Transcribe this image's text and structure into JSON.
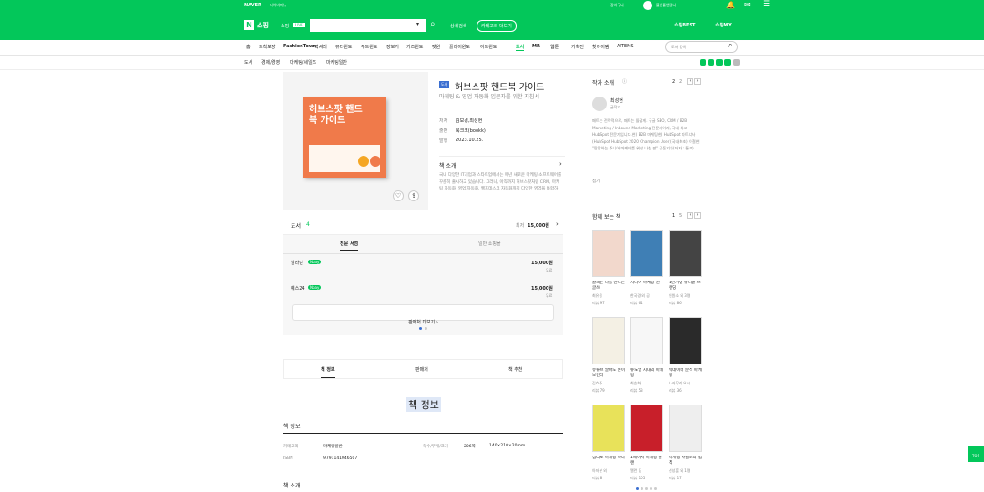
{
  "top": {
    "naver": "NAVER",
    "menu": "네이버메뉴",
    "pay": "장바구니",
    "user": "블신플앤클니",
    "icons": [
      "bell-icon",
      "mail-icon",
      "menu-icon"
    ]
  },
  "header": {
    "logo_n": "N",
    "logo_text": "쇼핑",
    "tab": "쇼핑",
    "live": "LIVE",
    "detail": "상세검색",
    "category": "카테고리 더보기",
    "best": "쇼핑BEST",
    "my": "쇼핑MY"
  },
  "nav": [
    "홈",
    "도착보장",
    "FashionTown",
    "럭셔리",
    "뷰티윈도",
    "푸드윈도",
    "장보기",
    "키즈윈도",
    "펫윈",
    "플레이윈도",
    "아트윈도",
    "도서",
    "MR",
    "웹툰",
    "기획전",
    "핫이이템",
    "AITEMS"
  ],
  "nav_search_placeholder": "도서 검색",
  "breadcrumb": [
    "도서",
    "경제/경영",
    "마케팅/세일즈",
    "마케팅일반"
  ],
  "book": {
    "tag": "도서",
    "title": "허브스팟 핸드북 가이드",
    "subtitle": "마케팅 & 영업 자동화 입문자를 위한 지침서",
    "author_label": "저자",
    "author": "김보경,최성현",
    "pub_label": "출판",
    "publisher": "북크크(bookk)",
    "date_label": "발행",
    "date": "2023.10.25.",
    "cover_title": "허브스팟 핸드북 가이드",
    "intro_title": "책 소개",
    "intro": "국내 다양한 IT기업과 스타트업에서는 매년 새로운 마케팅 소프트웨어를 꾸준히 출시하고 있습니다. 그러나, 아직까지 허브스팟처럼 CRM, 마케팅 자동화, 영업 자동화, 헬프데스크 자동화까지 다양한 영역을 통합하"
  },
  "stores": {
    "label": "도서",
    "count": "4",
    "lowest_label": "최저",
    "lowest": "15,000원",
    "tab1": "전문 서점",
    "tab2": "일반 쇼핑몰",
    "rows": [
      {
        "name": "알라딘",
        "pay": "Npay",
        "price": "15,000원",
        "ship": "무료"
      },
      {
        "name": "예스24",
        "pay": "Npay",
        "price": "15,000원",
        "ship": "무료"
      }
    ],
    "more": "판매처 더보기"
  },
  "tabs": [
    "책 정보",
    "판매처",
    "책 추천"
  ],
  "info": {
    "big_title": "책 정보",
    "section": "책 정보",
    "cat_label": "카테고리",
    "cat": "마케팅일반",
    "pages_label": "쪽수/무게/크기",
    "pages": "206쪽",
    "size": "140×210×20mm",
    "isbn_label": "ISBN",
    "isbn": "9791141046507",
    "intro2": "책 소개"
  },
  "author_box": {
    "title": "작가 소개",
    "page": "2",
    "total": "2",
    "name": "최성현",
    "role": "글작가",
    "text": "패트는 전략적으로, 패트는 뜰감게. 구글 SEO, CRM / B2B Marketing / Inbound Marketing 전문가이자, 국내 최고 HubSpot 전문가입니다.현) B2B 마케팅현) HubSpot 파트너사 (HubSpot HubSpot 2020 Champion User)(국내최초) 이철현 \"팡팡하는 주니어 마케터를 위한 나침 판\" 공동기자(저자 : 통조)",
    "more": "접기"
  },
  "recs": {
    "title": "함께 보는 책",
    "page": "1",
    "total": "5",
    "items": [
      {
        "t": "끌리는 나를 만드는 글쓰",
        "a": "최유웅",
        "r": "리뷰 97"
      },
      {
        "t": "시니어 마케팅 전",
        "a": "한국경 외 공",
        "r": "리뷰 61"
      },
      {
        "t": "1인기업 유니얼 브랜딩",
        "a": "인원소 외 3명",
        "r": "리뷰 86"
      },
      {
        "t": "유튜브 알바도 돈이 보인다",
        "a": "김효주",
        "r": "리뷰 79"
      },
      {
        "t": "뉴노멀 시대의 마케팅",
        "a": "최승화",
        "r": "리뷰 53"
      },
      {
        "t": "빅데이터 분석 마케팅",
        "a": "나카무라 요시",
        "r": "리뷰 36"
      },
      {
        "t": "심리로 마케팅 하다",
        "a": "아저분 외",
        "r": "리뷰 8"
      },
      {
        "t": "1페이지 마케팅 플랜",
        "a": "앨런 딥",
        "r": "리뷰 105"
      },
      {
        "t": "마케팅 차별화의 법칙",
        "a": "신성훈 외 1명",
        "r": "리뷰 17"
      }
    ]
  },
  "top_button": "TOP",
  "colors": {
    "green": "#03c75a",
    "blue": "#3b6fd1"
  }
}
